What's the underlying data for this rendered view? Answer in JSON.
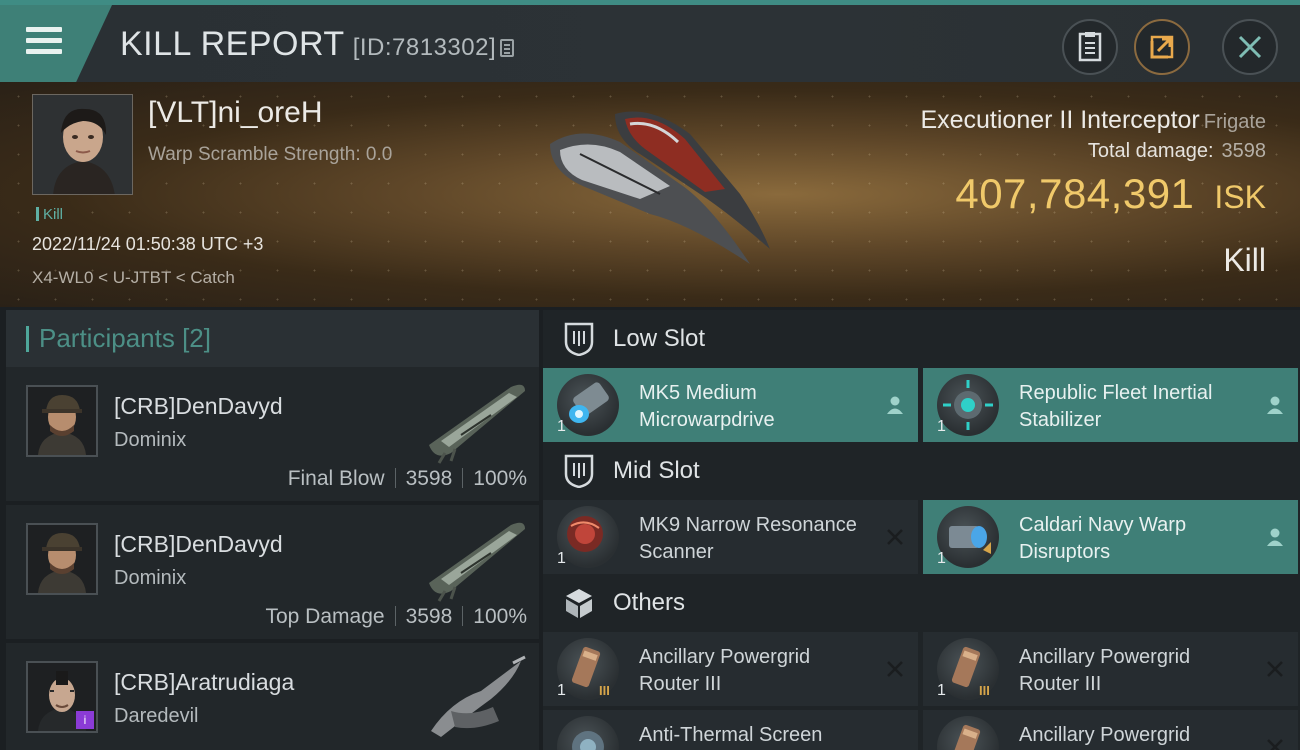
{
  "header": {
    "title": "KILL REPORT",
    "report_id": "[ID:7813302]"
  },
  "victim": {
    "name": "[VLT]ni_oreH",
    "warp_scramble": "Warp Scramble Strength: 0.0",
    "tag": "Kill",
    "datetime": "2022/11/24 01:50:38 UTC +3",
    "route": "X4-WL0 < U-JTBT < Catch",
    "ship": "Executioner II Interceptor",
    "ship_class": "Frigate",
    "total_damage_label": "Total damage:",
    "total_damage": "3598",
    "isk_value": "407,784,391",
    "isk_unit": "ISK",
    "result": "Kill"
  },
  "participants": {
    "label": "Participants",
    "count": "[2]",
    "items": [
      {
        "name": "[CRB]DenDavyd",
        "ship": "Dominix",
        "role": "Final Blow",
        "damage": "3598",
        "percent": "100%"
      },
      {
        "name": "[CRB]DenDavyd",
        "ship": "Dominix",
        "role": "Top Damage",
        "damage": "3598",
        "percent": "100%"
      },
      {
        "name": "[CRB]Aratrudiaga",
        "ship": "Daredevil",
        "role": "",
        "damage": "",
        "percent": ""
      }
    ]
  },
  "slots": {
    "low": {
      "label": "Low Slot",
      "modules": [
        {
          "name": "MK5 Medium Microwarpdrive",
          "qty": "1",
          "status": "dropped"
        },
        {
          "name": "Republic Fleet Inertial Stabilizer",
          "qty": "1",
          "status": "dropped"
        }
      ]
    },
    "mid": {
      "label": "Mid Slot",
      "modules": [
        {
          "name": "MK9 Narrow Resonance Scanner",
          "qty": "1",
          "status": "destroyed"
        },
        {
          "name": "Caldari Navy Warp Disruptors",
          "qty": "1",
          "status": "dropped"
        }
      ]
    },
    "others": {
      "label": "Others",
      "modules": [
        {
          "name": "Ancillary Powergrid Router III",
          "qty": "1",
          "status": "destroyed",
          "tier": "III"
        },
        {
          "name": "Ancillary Powergrid Router III",
          "qty": "1",
          "status": "destroyed",
          "tier": "III"
        },
        {
          "name": "Anti-Thermal Screen",
          "qty": "",
          "status": "destroyed"
        },
        {
          "name": "Ancillary Powergrid",
          "qty": "",
          "status": "destroyed"
        }
      ]
    }
  },
  "icons": {
    "menu": "hamburger-menu-icon",
    "copy": "copy-icon",
    "clipboard": "clipboard-icon",
    "share": "share-icon",
    "close": "close-icon",
    "shield": "shield-icon",
    "box": "box-icon",
    "person": "person-icon",
    "cross": "x-mark-icon"
  },
  "colors": {
    "accent": "#3f8c84",
    "isk": "#f0c96a",
    "dropped_row": "#3f7f77"
  }
}
